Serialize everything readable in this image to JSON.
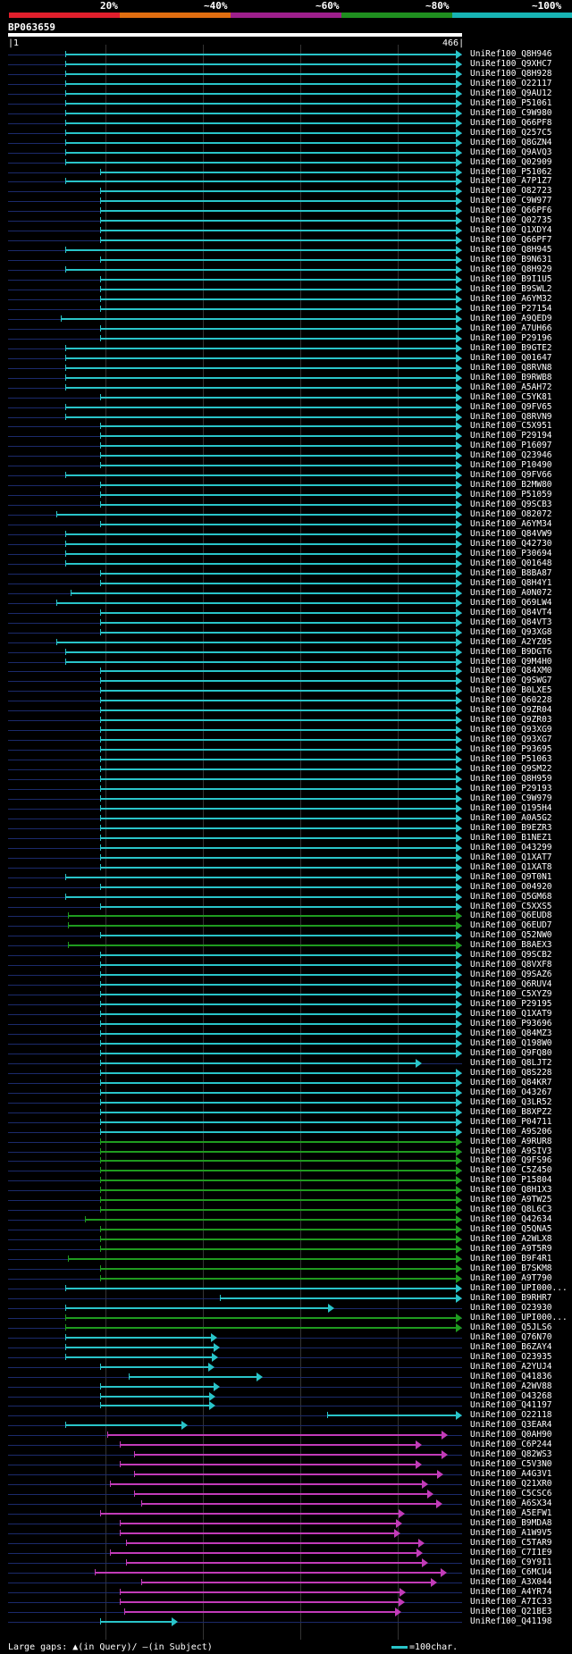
{
  "scale": {
    "labels": [
      "20%",
      "~40%",
      "~60%",
      "~80%",
      "~100%"
    ],
    "colors": [
      "#e01f2c",
      "#e06d10",
      "#9e1f8c",
      "#1f8f1f",
      "#17b4b4"
    ]
  },
  "query": {
    "id": "BP063659",
    "start": "1",
    "end": "466"
  },
  "colors": {
    "cyan": "#29c4c9",
    "green": "#1f9b1f",
    "magenta": "#c23bb8",
    "track": "#1b2a6b"
  },
  "hits": [
    {
      "id": "UniRef100_Q8H946",
      "color": "cyan",
      "start": 60,
      "end": 466
    },
    {
      "id": "UniRef100_Q9XHC7",
      "color": "cyan",
      "start": 60,
      "end": 466
    },
    {
      "id": "UniRef100_Q8H928",
      "color": "cyan",
      "start": 60,
      "end": 466
    },
    {
      "id": "UniRef100_O22117",
      "color": "cyan",
      "start": 60,
      "end": 466
    },
    {
      "id": "UniRef100_Q9AU12",
      "color": "cyan",
      "start": 60,
      "end": 466
    },
    {
      "id": "UniRef100_P51061",
      "color": "cyan",
      "start": 60,
      "end": 466
    },
    {
      "id": "UniRef100_C9W980",
      "color": "cyan",
      "start": 60,
      "end": 466
    },
    {
      "id": "UniRef100_Q66PF8",
      "color": "cyan",
      "start": 60,
      "end": 466
    },
    {
      "id": "UniRef100_Q257C5",
      "color": "cyan",
      "start": 60,
      "end": 466
    },
    {
      "id": "UniRef100_Q8GZN4",
      "color": "cyan",
      "start": 60,
      "end": 466
    },
    {
      "id": "UniRef100_Q9AVQ3",
      "color": "cyan",
      "start": 60,
      "end": 466
    },
    {
      "id": "UniRef100_Q02909",
      "color": "cyan",
      "start": 60,
      "end": 466
    },
    {
      "id": "UniRef100_P51062",
      "color": "cyan",
      "start": 95,
      "end": 466
    },
    {
      "id": "UniRef100_A7P1Z7",
      "color": "cyan",
      "start": 60,
      "end": 466
    },
    {
      "id": "UniRef100_O82723",
      "color": "cyan",
      "start": 95,
      "end": 466
    },
    {
      "id": "UniRef100_C9W977",
      "color": "cyan",
      "start": 95,
      "end": 466
    },
    {
      "id": "UniRef100_Q66PF6",
      "color": "cyan",
      "start": 95,
      "end": 466
    },
    {
      "id": "UniRef100_Q02735",
      "color": "cyan",
      "start": 95,
      "end": 466
    },
    {
      "id": "UniRef100_Q1XDY4",
      "color": "cyan",
      "start": 95,
      "end": 466
    },
    {
      "id": "UniRef100_Q66PF7",
      "color": "cyan",
      "start": 95,
      "end": 466
    },
    {
      "id": "UniRef100_Q8H945",
      "color": "cyan",
      "start": 60,
      "end": 466
    },
    {
      "id": "UniRef100_B9N631",
      "color": "cyan",
      "start": 95,
      "end": 466
    },
    {
      "id": "UniRef100_Q8H929",
      "color": "cyan",
      "start": 60,
      "end": 466
    },
    {
      "id": "UniRef100_B9I1U5",
      "color": "cyan",
      "start": 95,
      "end": 466
    },
    {
      "id": "UniRef100_B9SWL2",
      "color": "cyan",
      "start": 95,
      "end": 466
    },
    {
      "id": "UniRef100_A6YM32",
      "color": "cyan",
      "start": 95,
      "end": 466
    },
    {
      "id": "UniRef100_P27154",
      "color": "cyan",
      "start": 95,
      "end": 466
    },
    {
      "id": "UniRef100_A9QED9",
      "color": "cyan",
      "start": 55,
      "end": 466
    },
    {
      "id": "UniRef100_A7UH66",
      "color": "cyan",
      "start": 95,
      "end": 466
    },
    {
      "id": "UniRef100_P29196",
      "color": "cyan",
      "start": 95,
      "end": 466
    },
    {
      "id": "UniRef100_B9GTE2",
      "color": "cyan",
      "start": 60,
      "end": 466
    },
    {
      "id": "UniRef100_Q01647",
      "color": "cyan",
      "start": 60,
      "end": 466
    },
    {
      "id": "UniRef100_Q8RVN8",
      "color": "cyan",
      "start": 60,
      "end": 466
    },
    {
      "id": "UniRef100_B9RWB8",
      "color": "cyan",
      "start": 60,
      "end": 466
    },
    {
      "id": "UniRef100_A5AH72",
      "color": "cyan",
      "start": 60,
      "end": 466
    },
    {
      "id": "UniRef100_C5YK81",
      "color": "cyan",
      "start": 95,
      "end": 466
    },
    {
      "id": "UniRef100_Q9FV65",
      "color": "cyan",
      "start": 60,
      "end": 466
    },
    {
      "id": "UniRef100_Q8RVN9",
      "color": "cyan",
      "start": 60,
      "end": 466
    },
    {
      "id": "UniRef100_C5X951",
      "color": "cyan",
      "start": 95,
      "end": 466
    },
    {
      "id": "UniRef100_P29194",
      "color": "cyan",
      "start": 95,
      "end": 466
    },
    {
      "id": "UniRef100_P16097",
      "color": "cyan",
      "start": 95,
      "end": 466
    },
    {
      "id": "UniRef100_Q23946",
      "color": "cyan",
      "start": 95,
      "end": 466
    },
    {
      "id": "UniRef100_P10490",
      "color": "cyan",
      "start": 95,
      "end": 466
    },
    {
      "id": "UniRef100_Q9FV66",
      "color": "cyan",
      "start": 60,
      "end": 466
    },
    {
      "id": "UniRef100_B2MW80",
      "color": "cyan",
      "start": 95,
      "end": 466
    },
    {
      "id": "UniRef100_P51059",
      "color": "cyan",
      "start": 95,
      "end": 466
    },
    {
      "id": "UniRef100_Q9SCB3",
      "color": "cyan",
      "start": 95,
      "end": 466
    },
    {
      "id": "UniRef100_O82072",
      "color": "cyan",
      "start": 50,
      "end": 466
    },
    {
      "id": "UniRef100_A6YM34",
      "color": "cyan",
      "start": 95,
      "end": 466
    },
    {
      "id": "UniRef100_Q84VW9",
      "color": "cyan",
      "start": 60,
      "end": 466
    },
    {
      "id": "UniRef100_Q42730",
      "color": "cyan",
      "start": 60,
      "end": 466
    },
    {
      "id": "UniRef100_P30694",
      "color": "cyan",
      "start": 60,
      "end": 466
    },
    {
      "id": "UniRef100_Q01648",
      "color": "cyan",
      "start": 60,
      "end": 466
    },
    {
      "id": "UniRef100_B8BA87",
      "color": "cyan",
      "start": 95,
      "end": 466
    },
    {
      "id": "UniRef100_Q8H4Y1",
      "color": "cyan",
      "start": 95,
      "end": 466
    },
    {
      "id": "UniRef100_A0N072",
      "color": "cyan",
      "start": 65,
      "end": 466
    },
    {
      "id": "UniRef100_Q69LW4",
      "color": "cyan",
      "start": 50,
      "end": 466
    },
    {
      "id": "UniRef100_Q84VT4",
      "color": "cyan",
      "start": 95,
      "end": 466
    },
    {
      "id": "UniRef100_Q84VT3",
      "color": "cyan",
      "start": 95,
      "end": 466
    },
    {
      "id": "UniRef100_Q93XG8",
      "color": "cyan",
      "start": 95,
      "end": 466
    },
    {
      "id": "UniRef100_A2YZ05",
      "color": "cyan",
      "start": 50,
      "end": 466
    },
    {
      "id": "UniRef100_B9DGT6",
      "color": "cyan",
      "start": 60,
      "end": 466
    },
    {
      "id": "UniRef100_Q9M4H0",
      "color": "cyan",
      "start": 60,
      "end": 466
    },
    {
      "id": "UniRef100_Q84XM0",
      "color": "cyan",
      "start": 95,
      "end": 466
    },
    {
      "id": "UniRef100_Q9SWG7",
      "color": "cyan",
      "start": 95,
      "end": 466
    },
    {
      "id": "UniRef100_B0LXE5",
      "color": "cyan",
      "start": 95,
      "end": 466
    },
    {
      "id": "UniRef100_Q60228",
      "color": "cyan",
      "start": 95,
      "end": 466
    },
    {
      "id": "UniRef100_Q9ZR04",
      "color": "cyan",
      "start": 95,
      "end": 466
    },
    {
      "id": "UniRef100_Q9ZR03",
      "color": "cyan",
      "start": 95,
      "end": 466
    },
    {
      "id": "UniRef100_Q93XG9",
      "color": "cyan",
      "start": 95,
      "end": 466
    },
    {
      "id": "UniRef100_Q93XG7",
      "color": "cyan",
      "start": 95,
      "end": 466
    },
    {
      "id": "UniRef100_P93695",
      "color": "cyan",
      "start": 95,
      "end": 466
    },
    {
      "id": "UniRef100_P51063",
      "color": "cyan",
      "start": 95,
      "end": 466
    },
    {
      "id": "UniRef100_Q9SM22",
      "color": "cyan",
      "start": 95,
      "end": 466
    },
    {
      "id": "UniRef100_Q8H959",
      "color": "cyan",
      "start": 95,
      "end": 466
    },
    {
      "id": "UniRef100_P29193",
      "color": "cyan",
      "start": 95,
      "end": 466
    },
    {
      "id": "UniRef100_C9W979",
      "color": "cyan",
      "start": 95,
      "end": 466
    },
    {
      "id": "UniRef100_Q195H4",
      "color": "cyan",
      "start": 95,
      "end": 466
    },
    {
      "id": "UniRef100_A0A5G2",
      "color": "cyan",
      "start": 95,
      "end": 466
    },
    {
      "id": "UniRef100_B9EZR3",
      "color": "cyan",
      "start": 95,
      "end": 466
    },
    {
      "id": "UniRef100_B1NEZ1",
      "color": "cyan",
      "start": 95,
      "end": 466
    },
    {
      "id": "UniRef100_O43299",
      "color": "cyan",
      "start": 95,
      "end": 466
    },
    {
      "id": "UniRef100_Q1XAT7",
      "color": "cyan",
      "start": 95,
      "end": 466
    },
    {
      "id": "UniRef100_Q1XAT8",
      "color": "cyan",
      "start": 95,
      "end": 466
    },
    {
      "id": "UniRef100_Q9T0N1",
      "color": "cyan",
      "start": 60,
      "end": 466
    },
    {
      "id": "UniRef100_O04920",
      "color": "cyan",
      "start": 95,
      "end": 466
    },
    {
      "id": "UniRef100_Q5GM68",
      "color": "cyan",
      "start": 60,
      "end": 466
    },
    {
      "id": "UniRef100_C5XXS5",
      "color": "cyan",
      "start": 95,
      "end": 466
    },
    {
      "id": "UniRef100_Q6EUD8",
      "color": "green",
      "start": 62,
      "end": 466
    },
    {
      "id": "UniRef100_Q6EUD7",
      "color": "green",
      "start": 62,
      "end": 466
    },
    {
      "id": "UniRef100_Q52NW0",
      "color": "cyan",
      "start": 95,
      "end": 466
    },
    {
      "id": "UniRef100_B8AEX3",
      "color": "green",
      "start": 62,
      "end": 466
    },
    {
      "id": "UniRef100_Q9SCB2",
      "color": "cyan",
      "start": 95,
      "end": 466
    },
    {
      "id": "UniRef100_Q8VXF8",
      "color": "cyan",
      "start": 95,
      "end": 466
    },
    {
      "id": "UniRef100_Q9SAZ6",
      "color": "cyan",
      "start": 95,
      "end": 466
    },
    {
      "id": "UniRef100_Q6RUV4",
      "color": "cyan",
      "start": 95,
      "end": 466
    },
    {
      "id": "UniRef100_C5XYZ9",
      "color": "cyan",
      "start": 95,
      "end": 466
    },
    {
      "id": "UniRef100_P29195",
      "color": "cyan",
      "start": 95,
      "end": 466
    },
    {
      "id": "UniRef100_Q1XAT9",
      "color": "cyan",
      "start": 95,
      "end": 466
    },
    {
      "id": "UniRef100_P93696",
      "color": "cyan",
      "start": 95,
      "end": 466
    },
    {
      "id": "UniRef100_Q84MZ3",
      "color": "cyan",
      "start": 95,
      "end": 466
    },
    {
      "id": "UniRef100_Q198W0",
      "color": "cyan",
      "start": 95,
      "end": 466
    },
    {
      "id": "UniRef100_Q9FQ80",
      "color": "cyan",
      "start": 95,
      "end": 466
    },
    {
      "id": "UniRef100_Q8LJT2",
      "color": "cyan",
      "start": 95,
      "end": 425
    },
    {
      "id": "UniRef100_Q8S228",
      "color": "cyan",
      "start": 95,
      "end": 466
    },
    {
      "id": "UniRef100_Q84KR7",
      "color": "cyan",
      "start": 95,
      "end": 466
    },
    {
      "id": "UniRef100_O43267",
      "color": "cyan",
      "start": 95,
      "end": 466
    },
    {
      "id": "UniRef100_Q3LR52",
      "color": "cyan",
      "start": 95,
      "end": 466
    },
    {
      "id": "UniRef100_B8XPZ2",
      "color": "cyan",
      "start": 95,
      "end": 466
    },
    {
      "id": "UniRef100_P04711",
      "color": "cyan",
      "start": 95,
      "end": 466
    },
    {
      "id": "UniRef100_A9S206",
      "color": "cyan",
      "start": 95,
      "end": 466
    },
    {
      "id": "UniRef100_A9RUR8",
      "color": "green",
      "start": 95,
      "end": 466
    },
    {
      "id": "UniRef100_A9SIV3",
      "color": "green",
      "start": 95,
      "end": 466
    },
    {
      "id": "UniRef100_Q9FS96",
      "color": "green",
      "start": 95,
      "end": 466
    },
    {
      "id": "UniRef100_C5Z450",
      "color": "green",
      "start": 95,
      "end": 466
    },
    {
      "id": "UniRef100_P15804",
      "color": "green",
      "start": 95,
      "end": 466
    },
    {
      "id": "UniRef100_Q8H1X3",
      "color": "green",
      "start": 95,
      "end": 466
    },
    {
      "id": "UniRef100_A9TW25",
      "color": "green",
      "start": 95,
      "end": 466
    },
    {
      "id": "UniRef100_Q8L6C3",
      "color": "green",
      "start": 95,
      "end": 466
    },
    {
      "id": "UniRef100_Q42634",
      "color": "green",
      "start": 80,
      "end": 466
    },
    {
      "id": "UniRef100_Q5QNA5",
      "color": "green",
      "start": 95,
      "end": 466
    },
    {
      "id": "UniRef100_A2WLX8",
      "color": "green",
      "start": 95,
      "end": 466
    },
    {
      "id": "UniRef100_A9T5R9",
      "color": "green",
      "start": 95,
      "end": 466
    },
    {
      "id": "UniRef100_B9F4R1",
      "color": "green",
      "start": 62,
      "end": 466
    },
    {
      "id": "UniRef100_B7SKM8",
      "color": "green",
      "start": 95,
      "end": 466
    },
    {
      "id": "UniRef100_A9T790",
      "color": "green",
      "start": 95,
      "end": 466
    },
    {
      "id": "UniRef100_UPI000...",
      "color": "cyan",
      "start": 60,
      "end": 466
    },
    {
      "id": "UniRef100_B9RHR7",
      "color": "cyan",
      "start": 218,
      "end": 466
    },
    {
      "id": "UniRef100_O23930",
      "color": "cyan",
      "start": 60,
      "end": 335
    },
    {
      "id": "UniRef100_UPI000...",
      "color": "green",
      "start": 60,
      "end": 466
    },
    {
      "id": "UniRef100_Q5JLS6",
      "color": "green",
      "start": 60,
      "end": 466
    },
    {
      "id": "UniRef100_Q76N70",
      "color": "cyan",
      "start": 60,
      "end": 215
    },
    {
      "id": "UniRef100_B6ZAY4",
      "color": "cyan",
      "start": 60,
      "end": 218
    },
    {
      "id": "UniRef100_O23935",
      "color": "cyan",
      "start": 60,
      "end": 216
    },
    {
      "id": "UniRef100_A2YUJ4",
      "color": "cyan",
      "start": 95,
      "end": 212
    },
    {
      "id": "UniRef100_Q41836",
      "color": "cyan",
      "start": 125,
      "end": 262
    },
    {
      "id": "UniRef100_A2WV88",
      "color": "cyan",
      "start": 95,
      "end": 218
    },
    {
      "id": "UniRef100_O43268",
      "color": "cyan",
      "start": 95,
      "end": 213
    },
    {
      "id": "UniRef100_Q41197",
      "color": "cyan",
      "start": 95,
      "end": 213
    },
    {
      "id": "UniRef100_O22118",
      "color": "cyan",
      "start": 328,
      "end": 466
    },
    {
      "id": "UniRef100_Q3EAR4",
      "color": "cyan",
      "start": 60,
      "end": 185
    },
    {
      "id": "UniRef100_Q0AH90",
      "color": "magenta",
      "start": 103,
      "end": 451
    },
    {
      "id": "UniRef100_C6P244",
      "color": "magenta",
      "start": 115,
      "end": 425
    },
    {
      "id": "UniRef100_Q82WS3",
      "color": "magenta",
      "start": 130,
      "end": 451
    },
    {
      "id": "UniRef100_C5V3N0",
      "color": "magenta",
      "start": 115,
      "end": 425
    },
    {
      "id": "UniRef100_A4G3V1",
      "color": "magenta",
      "start": 130,
      "end": 447
    },
    {
      "id": "UniRef100_Q21XR0",
      "color": "magenta",
      "start": 105,
      "end": 431
    },
    {
      "id": "UniRef100_C5CSC6",
      "color": "magenta",
      "start": 130,
      "end": 437
    },
    {
      "id": "UniRef100_A6SX34",
      "color": "magenta",
      "start": 137,
      "end": 446
    },
    {
      "id": "UniRef100_A5EFW1",
      "color": "magenta",
      "start": 95,
      "end": 407
    },
    {
      "id": "UniRef100_B9MDA8",
      "color": "magenta",
      "start": 115,
      "end": 405
    },
    {
      "id": "UniRef100_A1W9V5",
      "color": "magenta",
      "start": 115,
      "end": 403
    },
    {
      "id": "UniRef100_C5TAR9",
      "color": "magenta",
      "start": 122,
      "end": 428
    },
    {
      "id": "UniRef100_C7I1E9",
      "color": "magenta",
      "start": 105,
      "end": 426
    },
    {
      "id": "UniRef100_C9Y9I1",
      "color": "magenta",
      "start": 122,
      "end": 431
    },
    {
      "id": "UniRef100_C6MCU4",
      "color": "magenta",
      "start": 90,
      "end": 450
    },
    {
      "id": "UniRef100_A3X044",
      "color": "magenta",
      "start": 137,
      "end": 440
    },
    {
      "id": "UniRef100_A4YR74",
      "color": "magenta",
      "start": 115,
      "end": 408
    },
    {
      "id": "UniRef100_A7IC33",
      "color": "magenta",
      "start": 115,
      "end": 407
    },
    {
      "id": "UniRef100_Q21BE3",
      "color": "magenta",
      "start": 120,
      "end": 404
    },
    {
      "id": "UniRef100_Q41198",
      "color": "cyan",
      "start": 95,
      "end": 175
    }
  ],
  "legend": {
    "gaps_label": "Large gaps:",
    "query_marker": "▲(in Query)/",
    "subject_marker": "—(in Subject)",
    "scale_label": "=100char."
  }
}
